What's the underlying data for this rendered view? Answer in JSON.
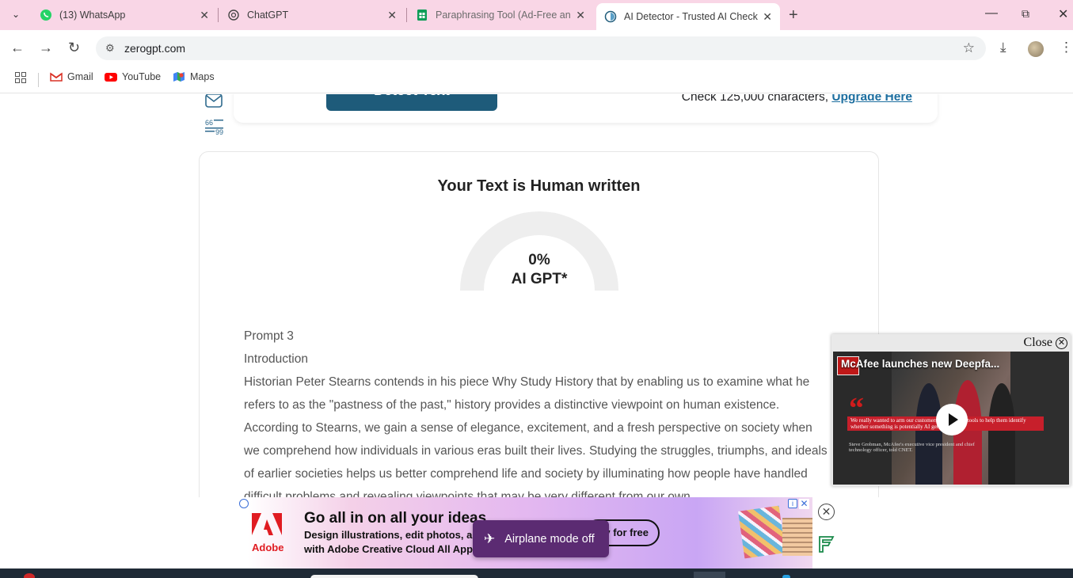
{
  "browser": {
    "tabs": [
      {
        "label": "(13) WhatsApp",
        "icon": "whatsapp-icon"
      },
      {
        "label": "ChatGPT",
        "icon": "chatgpt-icon"
      },
      {
        "label": "Paraphrasing Tool (Ad-Free and",
        "icon": "sheets-icon"
      },
      {
        "label": "AI Detector - Trusted AI Checke",
        "icon": "zerogpt-icon",
        "active": true
      }
    ],
    "url": "zerogpt.com",
    "bookmarks": [
      {
        "label": "Gmail",
        "icon": "gmail-icon"
      },
      {
        "label": "YouTube",
        "icon": "youtube-icon"
      },
      {
        "label": "Maps",
        "icon": "maps-icon"
      }
    ]
  },
  "page": {
    "detect_button": "Detect Text",
    "upgrade_text": "Check 125,000 characters, ",
    "upgrade_link": "Upgrade Here",
    "result_title": "Your Text is Human written",
    "gauge_percent": "0%",
    "gauge_value": 0,
    "gauge_label": "AI GPT*",
    "text_lines": [
      "Prompt 3",
      "Introduction",
      "Historian Peter Stearns contends in his piece Why Study History that by enabling us to examine what he refers to as the \"pastness of the past,\" history provides a distinctive viewpoint on human existence. According to Stearns, we gain a sense of elegance, excitement, and a fresh perspective on society when we comprehend how individuals in various eras built their lives. Studying the struggles, triumphs, and ideals of earlier societies helps us better comprehend life and society by illuminating how people have handled difficult problems and revealing viewpoints that may be very different from our own."
    ]
  },
  "video": {
    "close_label": "Close",
    "headline": "McAfee launches new Deepfa...",
    "quote_text": "We really wanted to arm our customers with a set of tools to help them identify whether something is potentially AI generated.",
    "caption": "Steve Grobman, McAfee's executive vice president and chief technology officer, told CNET."
  },
  "ad": {
    "brand": "Adobe",
    "headline": "Go all in on all your ideas.",
    "sub1": "Design illustrations, edit photos, and more",
    "sub2": "with Adobe Creative Cloud All Apps.",
    "cta": "Try for free"
  },
  "toast": {
    "label": "Airplane mode off"
  },
  "colors": {
    "tabbar": "#f9d6e6",
    "detect_button": "#1e5b7a",
    "link": "#1e6fa0",
    "toast": "#5b2b72"
  }
}
